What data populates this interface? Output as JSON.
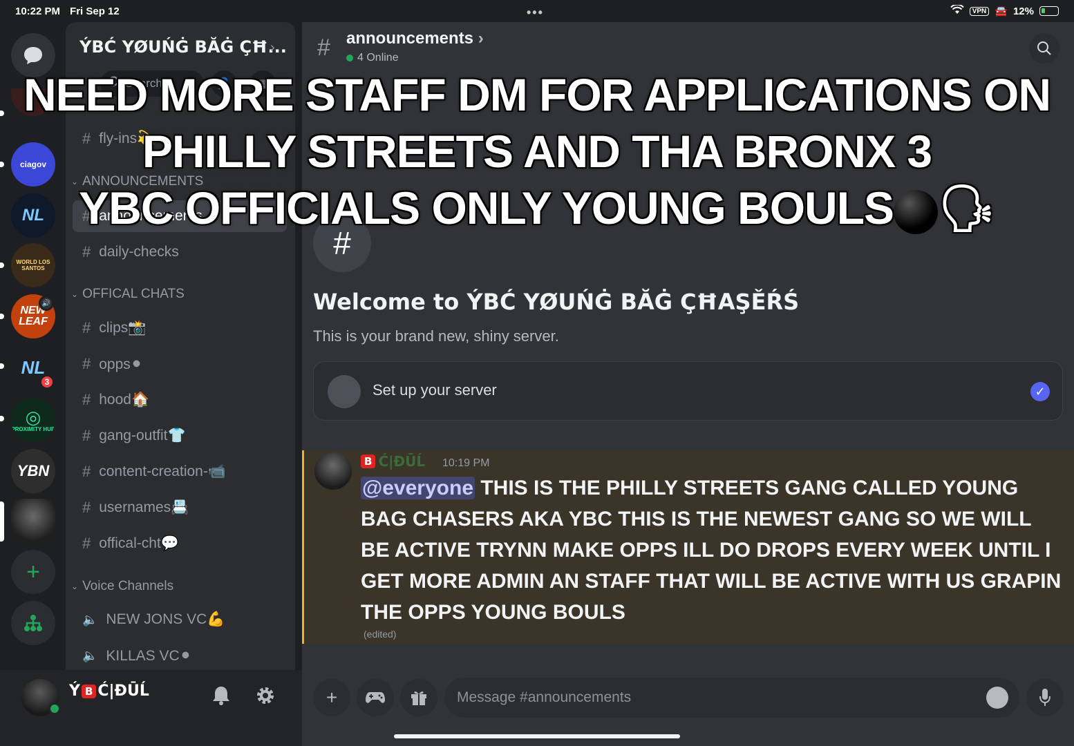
{
  "status_bar": {
    "time": "10:22 PM",
    "date": "Fri Sep 12",
    "vpn": "VPN",
    "battery": "12%"
  },
  "rail": {
    "servers": [
      {
        "name": "direct-messages"
      },
      {
        "name": "ciagov",
        "label": "ciagov"
      },
      {
        "name": "nl-server",
        "label": "NL"
      },
      {
        "name": "world-los-santos",
        "label": "WORLD LOS SANTOS"
      },
      {
        "name": "new-leaf",
        "label": "NEW LEAF"
      },
      {
        "name": "nl-server-2",
        "label": "NL",
        "badge": "3"
      },
      {
        "name": "proximity-hub",
        "label": "PROXIMITY HUB"
      },
      {
        "name": "ybn",
        "label": "YBN"
      },
      {
        "name": "ybc"
      }
    ],
    "colors": {
      "ciagov": "#3b47d6",
      "proximity": "#0d2a1c"
    }
  },
  "sidebar": {
    "server_name": "ÝBĆ YØUŃĠ BĂĠ ÇĦ...",
    "search_label": "Search",
    "channels_top": [
      {
        "label": "fly-ins💫"
      }
    ],
    "categories": {
      "announcements": "ANNOUNCEMENTS",
      "offical_chats": "OFFICAL CHATS",
      "voice": "Voice Channels"
    },
    "announcement_channels": [
      {
        "label": "announcements"
      },
      {
        "label": "daily-checks"
      }
    ],
    "offical_channels": [
      {
        "label": "clips📸"
      },
      {
        "label": "opps⚫"
      },
      {
        "label": "hood🏠"
      },
      {
        "label": "gang-outfit👕"
      },
      {
        "label": "content-creation-📹"
      },
      {
        "label": "usernames📇"
      },
      {
        "label": "offical-cht💬"
      }
    ],
    "voice_channels": [
      {
        "label": "NEW JONS VC💪"
      },
      {
        "label": "KILLAS VC⚫"
      }
    ]
  },
  "user_panel": {
    "name_prefix": "Ý",
    "name_box": "B",
    "name_suffix": "Ć|ĐŪĹ"
  },
  "header": {
    "title": "announcements",
    "online": "4 Online"
  },
  "welcome": {
    "title": "Welcome to ÝBĆ YØUŃĠ BĂĠ ÇĦAŞĚŔŚ",
    "subtitle": "This is your brand new, shiny server.",
    "setup_label": "Set up your server"
  },
  "message": {
    "author_box": "B",
    "author_name": "Ć|ĐŪĹ",
    "time": "10:19 PM",
    "mention": "@everyone",
    "text": " THIS IS THE PHILLY STREETS GANG CALLED YOUNG BAG CHASERS AKA YBC THIS IS THE NEWEST GANG SO WE WILL BE ACTIVE TRYNN MAKE OPPS ILL DO DROPS EVERY WEEK UNTIL I GET MORE ADMIN AN STAFF THAT WILL BE ACTIVE WITH US GRAPIN THE OPPS YOUNG BOULS",
    "edited": "(edited)"
  },
  "composer": {
    "placeholder": "Message #announcements"
  },
  "overlay": {
    "line1": "NEED MORE STAFF DM FOR APPLICATIONS ON",
    "line2": "PHILLY STREETS AND THA BRONX 3",
    "line3": "YBC OFFICIALS ONLY YOUNG BOULS",
    "emoji_end": "🗣"
  }
}
